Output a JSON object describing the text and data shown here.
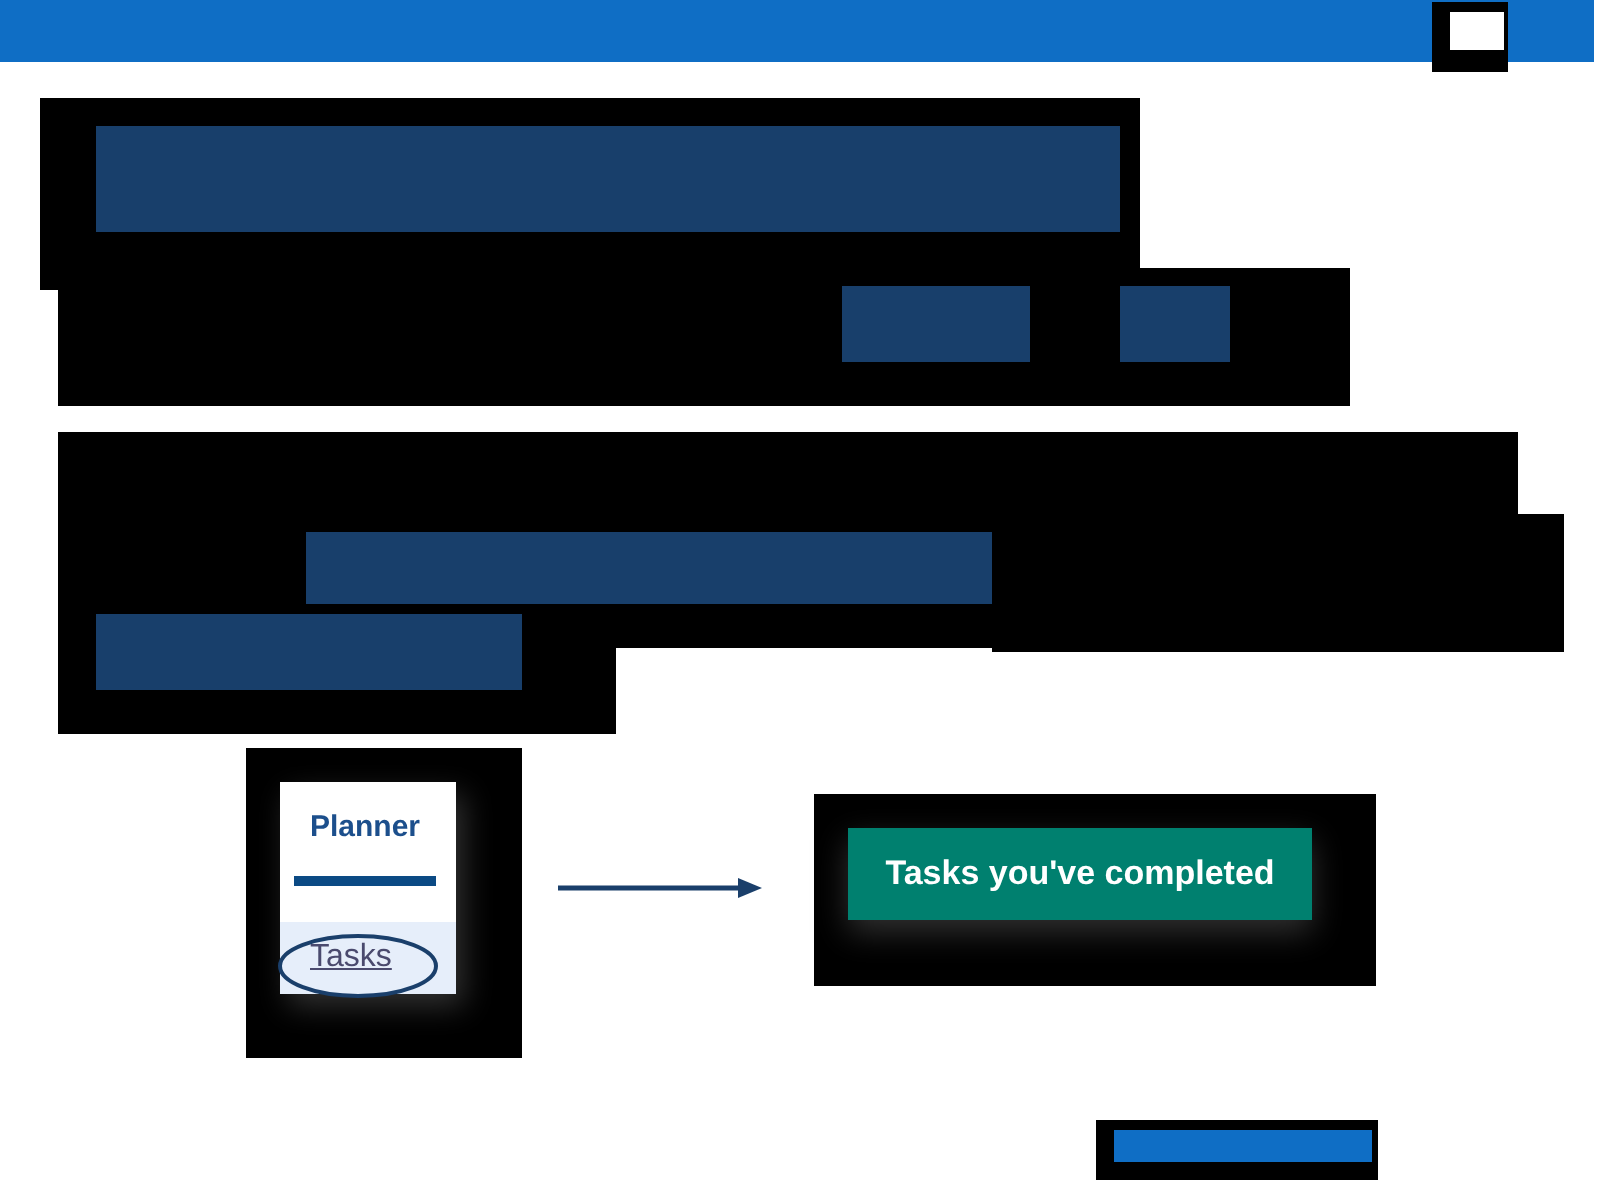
{
  "planner_panel": {
    "tabs": [
      {
        "label": "Planner",
        "selected": true
      }
    ],
    "items": [
      {
        "label": "Tasks",
        "selected": true,
        "circled": true
      }
    ]
  },
  "result_button": {
    "label": "Tasks you've completed"
  }
}
